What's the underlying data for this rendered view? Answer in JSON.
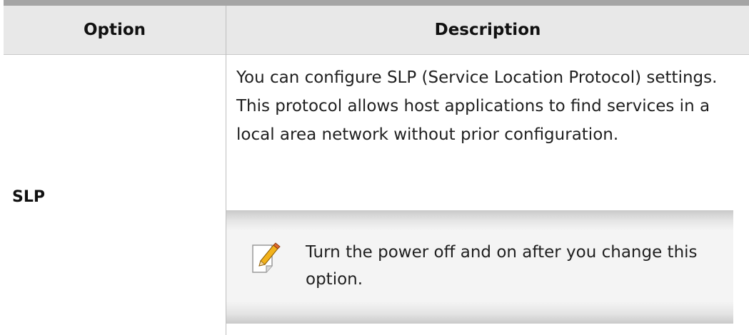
{
  "table": {
    "headers": {
      "option": "Option",
      "description": "Description"
    },
    "rows": [
      {
        "option": "SLP",
        "description": "You can configure SLP (Service Location Protocol) settings. This protocol allows host applications to find services in a local area network without prior configuration.",
        "note": {
          "icon": "note-pencil-icon",
          "text": "Turn the power off and on after you change this option."
        }
      }
    ]
  },
  "colors": {
    "header_background": "#e8e8e8",
    "top_rule": "#a5a5a5",
    "note_background": "#f4f4f4"
  }
}
